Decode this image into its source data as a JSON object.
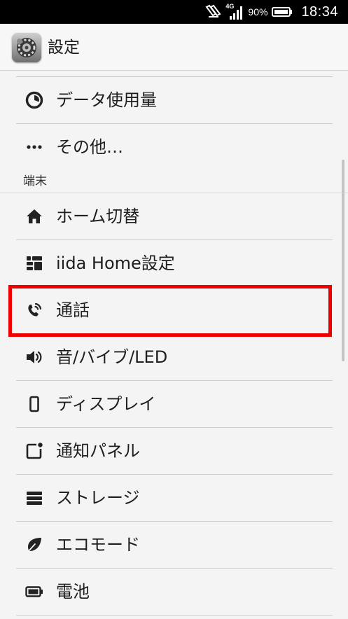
{
  "status_bar": {
    "network_label": "4G",
    "battery_percent": "90%",
    "time": "18:34"
  },
  "app_bar": {
    "title": "設定",
    "icon": "settings-gear-icon"
  },
  "section_device": "端末",
  "items": [
    {
      "label": "データ使用量",
      "icon": "data-usage-icon"
    },
    {
      "label": "その他…",
      "icon": "more-dots-icon"
    },
    {
      "label": "ホーム切替",
      "icon": "home-icon"
    },
    {
      "label": "iida Home設定",
      "icon": "grid-tiles-icon"
    },
    {
      "label": "通話",
      "icon": "phone-icon"
    },
    {
      "label": "音/バイブ/LED",
      "icon": "speaker-icon"
    },
    {
      "label": "ディスプレイ",
      "icon": "display-icon"
    },
    {
      "label": "通知パネル",
      "icon": "notification-panel-icon"
    },
    {
      "label": "ストレージ",
      "icon": "storage-icon"
    },
    {
      "label": "エコモード",
      "icon": "leaf-icon"
    },
    {
      "label": "電池",
      "icon": "battery-icon"
    }
  ],
  "highlight": {
    "item": "通話",
    "color": "#ee0000"
  }
}
